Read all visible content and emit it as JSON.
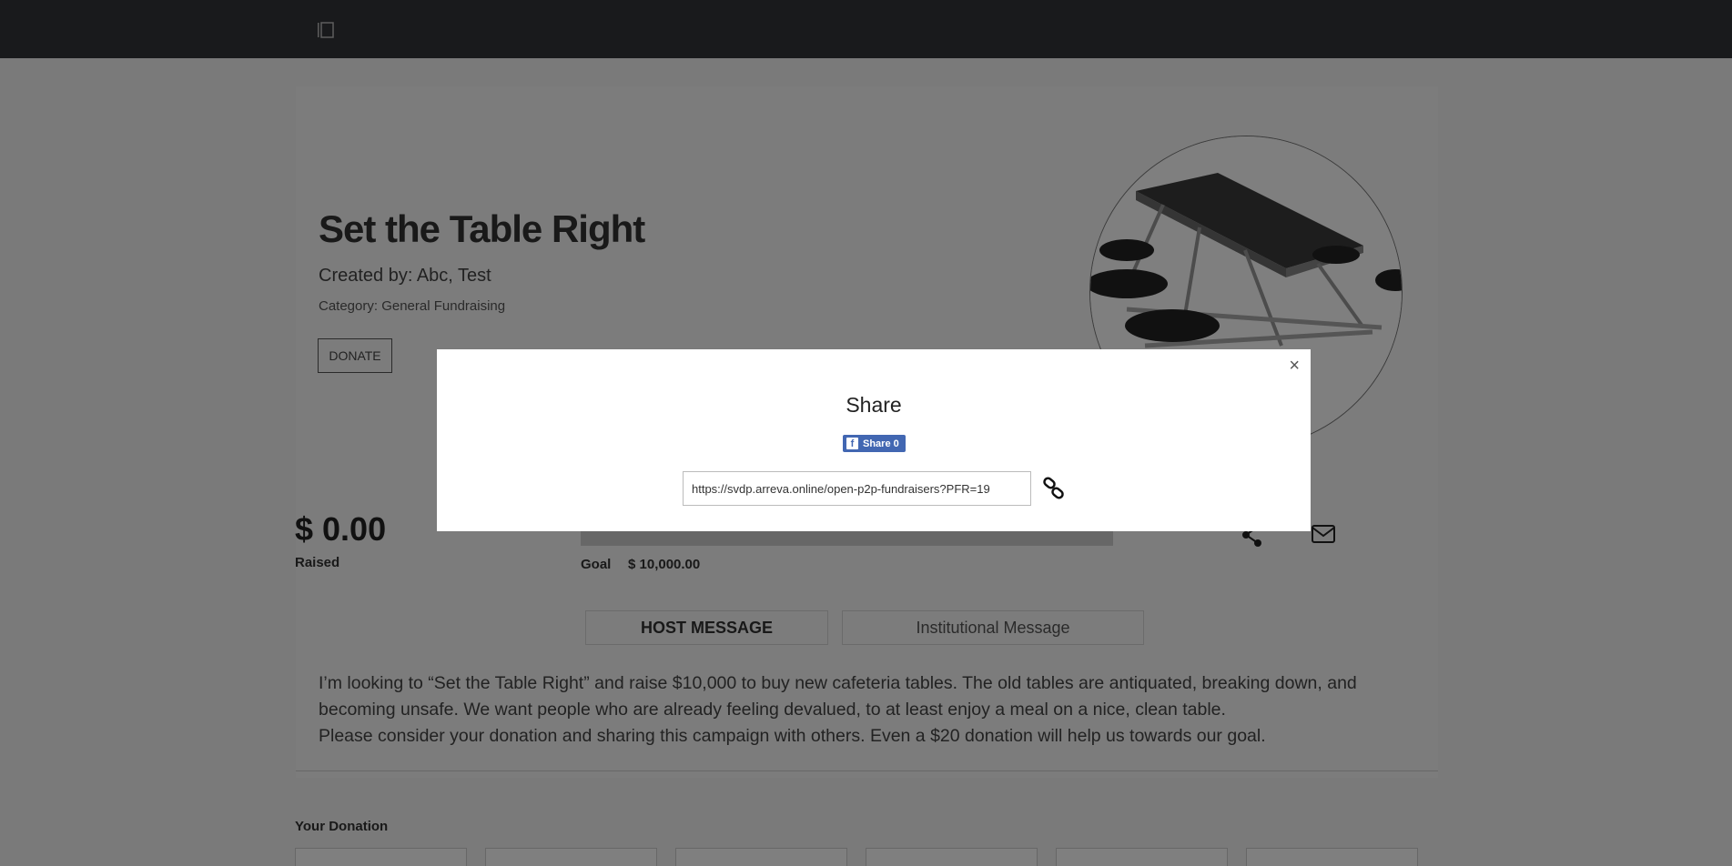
{
  "campaign": {
    "title": "Set the Table Right",
    "created_by": "Created by: Abc, Test",
    "category": "Category: General Fundraising",
    "donate_label": "DONATE"
  },
  "stats": {
    "raised_amount": "$ 0.00",
    "raised_label": "Raised",
    "progress_fraction": 0,
    "goal_label": "Goal",
    "goal_value": "$ 10,000.00"
  },
  "tabs": [
    {
      "label": "HOST MESSAGE",
      "active": true
    },
    {
      "label": "Institutional Message",
      "active": false
    }
  ],
  "message": {
    "line1": "I’m looking to “Set the Table Right” and raise $10,000 to buy new cafeteria tables. The old tables are antiquated, breaking down, and becoming unsafe. We want people who are already feeling devalued, to at least enjoy a meal on a nice, clean table.",
    "line2": "Please consider your donation and sharing this campaign with others. Even a $20 donation will help us towards our goal."
  },
  "donation": {
    "heading": "Your Donation"
  },
  "share_modal": {
    "close": "×",
    "title": "Share",
    "fb_label": "Share 0",
    "url": "https://svdp.arreva.online/open-p2p-fundraisers?PFR=19"
  },
  "icons": {
    "menu": "menu-icon",
    "share": "share-icon",
    "mail": "mail-icon",
    "facebook": "facebook-icon",
    "copy_link": "link-icon"
  },
  "colors": {
    "topbar": "#323439",
    "facebook": "#4267b2"
  }
}
